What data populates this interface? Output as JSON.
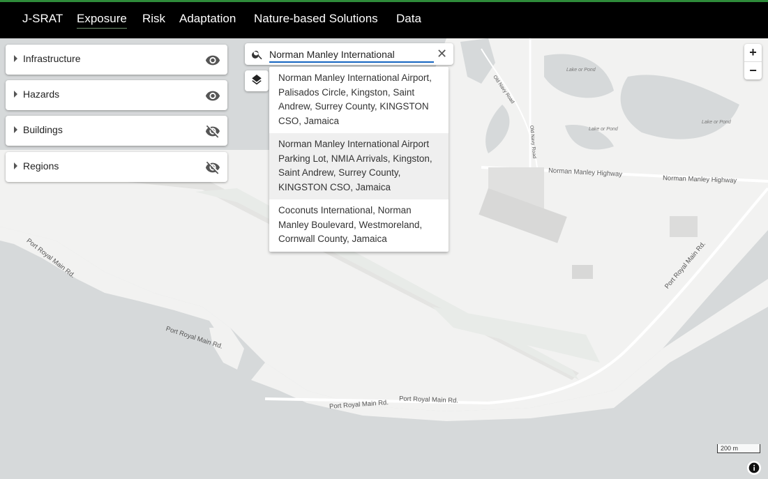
{
  "nav": {
    "brand": "J-SRAT",
    "items": [
      "Exposure",
      "Risk",
      "Adaptation",
      "Nature-based Solutions",
      "Data"
    ],
    "active": "Exposure"
  },
  "layers": [
    {
      "label": "Infrastructure",
      "visible": true
    },
    {
      "label": "Hazards",
      "visible": true
    },
    {
      "label": "Buildings",
      "visible": false
    },
    {
      "label": "Regions",
      "visible": false
    }
  ],
  "search": {
    "value": "Norman Manley International",
    "results": [
      "Norman Manley International Airport, Palisados Circle, Kingston, Saint Andrew, Surrey County, KINGSTON CSO, Jamaica",
      "Norman Manley International Airport Parking Lot, NMIA Arrivals, Kingston, Saint Andrew, Surrey County, KINGSTON CSO, Jamaica",
      "Coconuts International, Norman Manley Boulevard, Westmoreland, Cornwall County, Jamaica"
    ]
  },
  "map_labels": {
    "old_navy_road_1": "Old Navy Road",
    "old_navy_road_2": "Old Navy Road",
    "lake_1": "Lake or Pond",
    "lake_2": "Lake or Pond",
    "lake_3": "Lake or Pond",
    "highway_1": "Norman Manley Highway",
    "highway_2": "Norman Manley Highway",
    "port_royal_1": "Port Royal Main Rd.",
    "port_royal_2": "Port Royal Main Rd.",
    "port_royal_3": "Port Royal Main Rd.",
    "port_royal_4": "Port Royal Main Rd.",
    "port_royal_5": "Port Royal Main Rd."
  },
  "zoom": {
    "in": "+",
    "out": "−"
  },
  "scale_label": "200 m",
  "colors": {
    "water": "#d6d9da",
    "land": "#f2f2f1",
    "accent": "#1565c0",
    "topbar": "#000000"
  }
}
